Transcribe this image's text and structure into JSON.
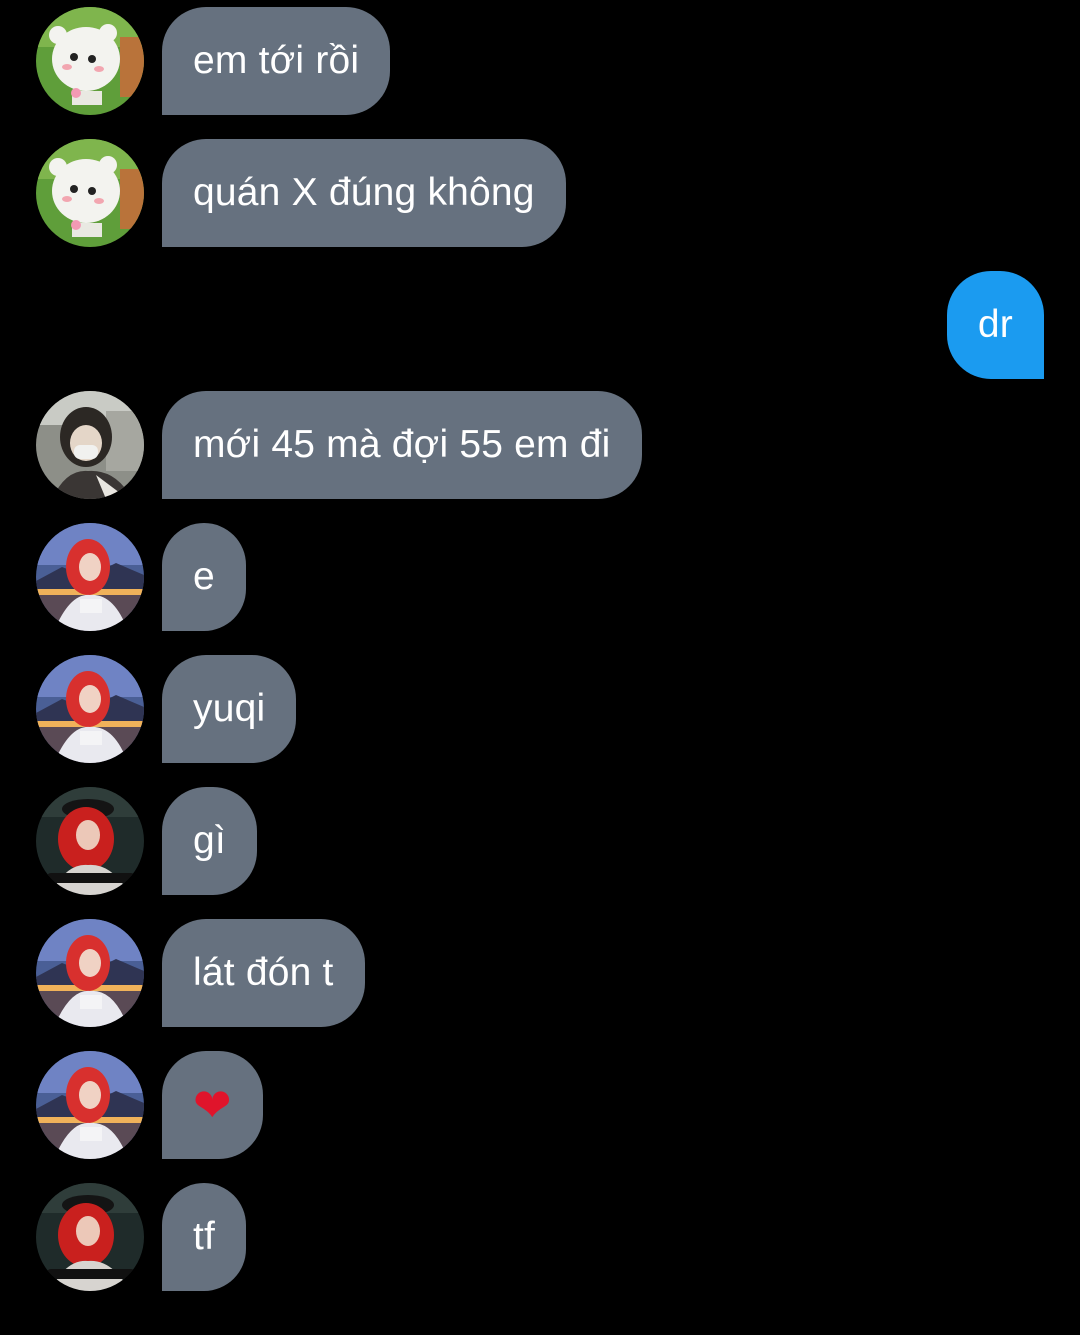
{
  "messages": [
    {
      "id": 1,
      "direction": "in",
      "sender_avatar": "white-bear-mascot",
      "text": "em tới rồi"
    },
    {
      "id": 2,
      "direction": "in",
      "sender_avatar": "white-bear-mascot",
      "text": "quán X đúng không"
    },
    {
      "id": 3,
      "direction": "out",
      "text": "dr"
    },
    {
      "id": 4,
      "direction": "in",
      "sender_avatar": "girl-mask-photo",
      "text": "mới 45 mà đợi 55 em đi"
    },
    {
      "id": 5,
      "direction": "in",
      "sender_avatar": "red-hair-girl-dusk",
      "text": "e"
    },
    {
      "id": 6,
      "direction": "in",
      "sender_avatar": "red-hair-girl-dusk",
      "text": "yuqi"
    },
    {
      "id": 7,
      "direction": "in",
      "sender_avatar": "red-hair-girl-motorbike",
      "text": "gì"
    },
    {
      "id": 8,
      "direction": "in",
      "sender_avatar": "red-hair-girl-dusk",
      "text": "lát đón t"
    },
    {
      "id": 9,
      "direction": "in",
      "sender_avatar": "red-hair-girl-dusk",
      "text": "❤",
      "icon": "red-heart-icon"
    },
    {
      "id": 10,
      "direction": "in",
      "sender_avatar": "red-hair-girl-motorbike",
      "text": "tf"
    }
  ],
  "colors": {
    "background": "#000000",
    "incoming_bubble": "#66717f",
    "outgoing_bubble": "#1b9bf0",
    "text": "#ffffff",
    "heart": "#e0142b"
  }
}
